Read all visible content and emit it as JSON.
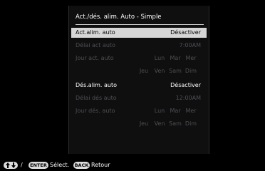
{
  "dialog": {
    "title": "Act./dés. alim. Auto - Simple",
    "rows": [
      {
        "label": "Act.alim. auto",
        "value": "Désactiver"
      },
      {
        "label": "Délai act auto",
        "value": "7:00AM"
      },
      {
        "label": "Jour act. auto"
      },
      {
        "label": "Dés.alim. auto",
        "value": "Désactiver"
      },
      {
        "label": "Délai dés auto",
        "value": "12:00AM"
      },
      {
        "label": "Jour dés. auto"
      }
    ],
    "days_line1": [
      "Lun",
      "Mar",
      "Mer"
    ],
    "days_line2": [
      "Jeu",
      "Ven",
      "Sam",
      "Dim"
    ]
  },
  "footer": {
    "arrows_icon": "up-down-arrows-icon",
    "slash": "/",
    "enter_label": "ENTER",
    "select_text": "Sélect.",
    "back_label": "BACK",
    "back_text": "Retour"
  },
  "colors": {
    "selected_row_bg": "#d6d6d6",
    "dim_text": "#4f4f53",
    "panel_bg": "#0f0f10"
  }
}
